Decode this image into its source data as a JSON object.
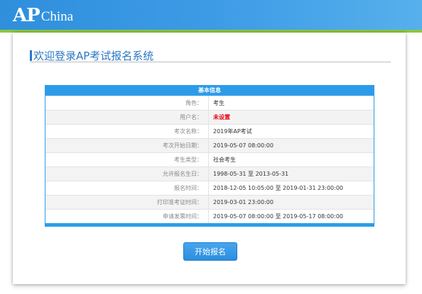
{
  "header": {
    "logo_ap": "AP",
    "logo_china": "China",
    "brand_color": "#3d9be6",
    "accent_color": "#8dc63f"
  },
  "panel": {
    "title": "欢迎登录AP考试报名系统"
  },
  "info_table": {
    "heading": "基本信息",
    "rows": [
      {
        "label": "角色：",
        "value": "考生"
      },
      {
        "label": "用户名：",
        "value": "未设置"
      },
      {
        "label": "考次名称：",
        "value": "2019年AP考试"
      },
      {
        "label": "考次开始日期：",
        "value": "2019-05-07 08:00:00"
      },
      {
        "label": "考生类型：",
        "value": "社会考生"
      },
      {
        "label": "允许报名生日：",
        "value": "1998-05-31 至 2013-05-31"
      },
      {
        "label": "报名时间：",
        "value": "2018-12-05 10:05:00 至 2019-01-31 23:00:00"
      },
      {
        "label": "打印准考证时间：",
        "value": "2019-03-01 23:00:00"
      },
      {
        "label": "申请发票时间：",
        "value": "2019-05-07 08:00:00 至 2019-05-17 08:00:00"
      }
    ]
  },
  "actions": {
    "start_button": "开始报名"
  }
}
